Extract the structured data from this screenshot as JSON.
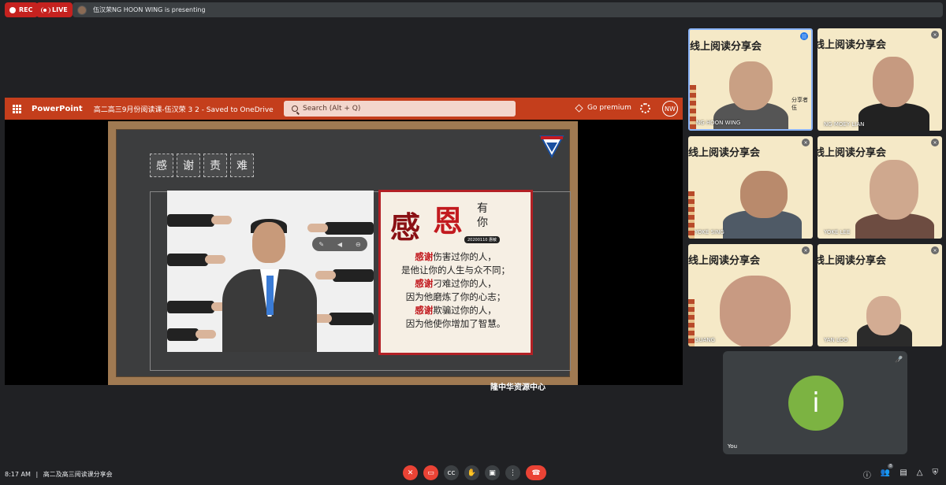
{
  "top": {
    "rec_label": "REC",
    "live_label": "LIVE",
    "presenting_text": "伍汉荣NG HOON WING is presenting"
  },
  "powerpoint": {
    "app_name": "PowerPoint",
    "document_title": "高二高三9月份阅读课-伍汉荣 3 2  -  Saved to OneDrive",
    "search_placeholder": "Search (Alt + Q)",
    "premium_label": "Go premium",
    "user_initials": "NW"
  },
  "slide": {
    "chips": [
      "感",
      "谢",
      "责",
      "难"
    ],
    "card_big_1": "感",
    "card_big_2": "恩",
    "card_small": "有你",
    "card_date": "20200110 惠敏",
    "lines": [
      {
        "red": "感谢",
        "rest": "伤害过你的人，"
      },
      {
        "red": "",
        "rest": "是他让你的人生与众不同；"
      },
      {
        "red": "感谢",
        "rest": "刁难过你的人，"
      },
      {
        "red": "",
        "rest": "因为他磨炼了你的心志；"
      },
      {
        "red": "感谢",
        "rest": "欺骗过你的人，"
      },
      {
        "red": "",
        "rest": "因为他使你增加了智慧。"
      }
    ],
    "footer": "隆中华资源中心"
  },
  "participants": [
    {
      "banner": "线上阅读分享会",
      "name": "NG HOON WING",
      "share_label": "分享者\n伍",
      "speaking": true
    },
    {
      "banner": "线上阅读分享会",
      "name": "NG MOEY LIAN",
      "speaking": false
    },
    {
      "banner": "线上阅读分享会",
      "name": "YOKE SING",
      "speaking": false
    },
    {
      "banner": "线上阅读分享会",
      "name": "YOKE LEE",
      "speaking": false
    },
    {
      "banner": "线上阅读分享会",
      "name": "GUANG",
      "speaking": false
    },
    {
      "banner": "线上阅读分享会",
      "name": "YAN LOO",
      "speaking": false
    }
  ],
  "you": {
    "initial": "i",
    "label": "You"
  },
  "bottom": {
    "time": "8:17 AM",
    "separator": "|",
    "meeting_name": "高二及高三阅读课分享会",
    "people_count": "8"
  },
  "colors": {
    "accent_red": "#ea4335",
    "ppt_orange": "#c43e1c",
    "you_green": "#7cb342"
  }
}
